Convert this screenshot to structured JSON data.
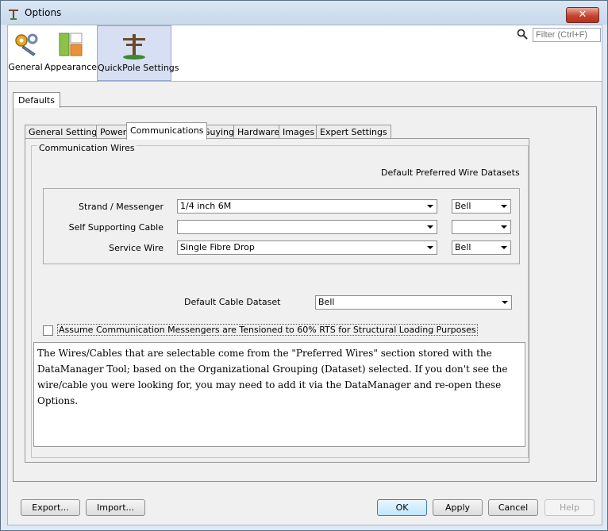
{
  "window": {
    "title": "Options",
    "close_glyph": "✕"
  },
  "search": {
    "placeholder": "Filter (Ctrl+F)"
  },
  "categories": [
    {
      "label": "General",
      "icon": "gears-icon"
    },
    {
      "label": "Appearance",
      "icon": "appearance-icon"
    },
    {
      "label": "QuickPole Settings",
      "icon": "pole-icon",
      "selected": true
    }
  ],
  "defaults_tab": "Defaults",
  "subtabs": [
    "General Settings",
    "Power",
    "Communications",
    "Guying",
    "Hardware",
    "Images",
    "Expert Settings"
  ],
  "active_subtab": "Communications",
  "group": {
    "title": "Communication Wires",
    "preferred_label": "Default Preferred Wire Datasets",
    "rows": [
      {
        "label": "Strand / Messenger",
        "value": "1/4 inch 6M",
        "dataset": "Bell"
      },
      {
        "label": "Self Supporting Cable",
        "value": "",
        "dataset": ""
      },
      {
        "label": "Service Wire",
        "value": "Single Fibre Drop",
        "dataset": "Bell"
      }
    ],
    "cable_dataset_label": "Default Cable Dataset",
    "cable_dataset_value": "Bell",
    "checkbox_label": "Assume Communication Messengers are Tensioned to 60% RTS for Structural Loading Purposes",
    "checkbox_checked": false,
    "note": "The Wires/Cables that are selectable come from the \"Preferred Wires\" section stored with the DataManager Tool; based on the Organizational Grouping (Dataset) selected. If you don't see the wire/cable you were looking for, you may need to add it via the DataManager and re-open these Options."
  },
  "buttons": {
    "export": "Export...",
    "import": "Import...",
    "ok": "OK",
    "apply": "Apply",
    "cancel": "Cancel",
    "help": "Help"
  },
  "colors": {
    "title_bg": "#c8d9ec",
    "close_red": "#c7432e",
    "selected_cat": "#d7dff2"
  }
}
